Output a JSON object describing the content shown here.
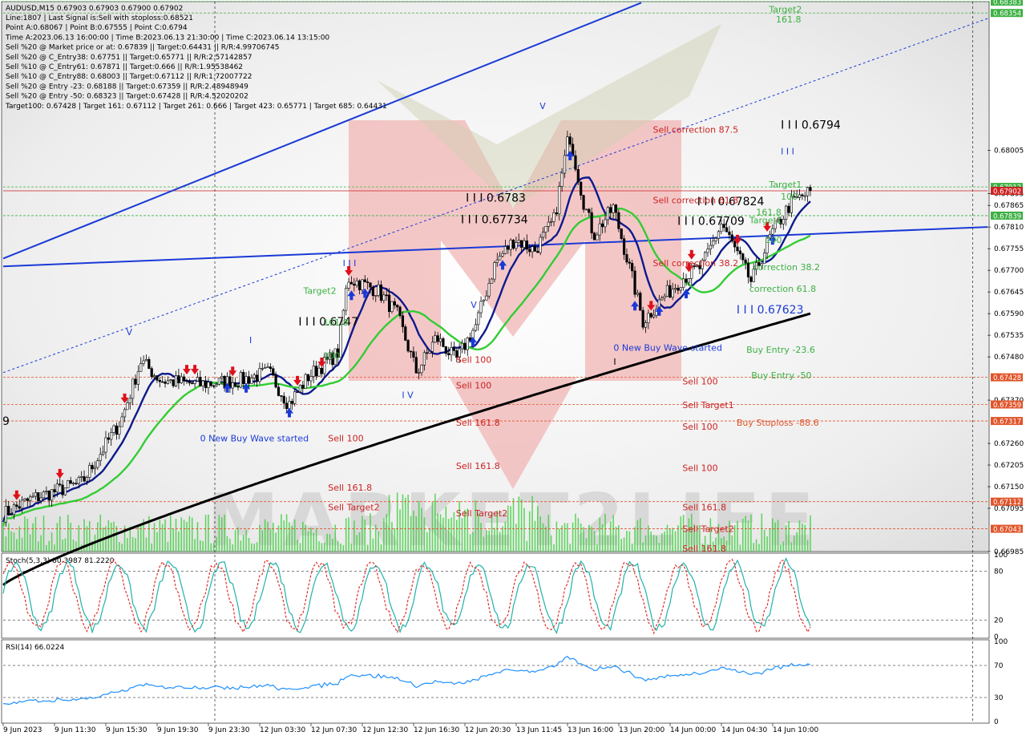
{
  "header": {
    "symbol_line": "AUDUSD,M15  0.67903 0.67903 0.67900 0.67902",
    "info_lines": [
      "Line:1807 | Last Signal is:Sell with stoploss:0.68521",
      "Point A:0.68067 | Point B:0.67555 | Point C:0.6794",
      "Time A:2023.06.13 16:00:00 | Time B:2023.06.13 21:30:00 | Time C:2023.06.14 13:15:00",
      "Sell %20 @ Market price or at: 0.67839 || Target:0.64431 || R/R:4.99706745",
      "Sell %20 @ C_Entry38: 0.67751 || Target:0.65771 || R/R:2.57142857",
      "Sell %10 @ C_Entry61: 0.67871 || Target:0.666 || R/R:1.95538462",
      "Sell %10 @ C_Entry88: 0.68003 || Target:0.67112 || R/R:1.72007722",
      "Sell %20 @ Entry -23: 0.68188 || Target:0.67359 || R/R:2.48948949",
      "Sell %20 @ Entry -50: 0.68323 || Target:0.67428 || R/R:4.52020202",
      "Target100: 0.67428 | Target 161: 0.67112 | Target 261: 0.666 | Target 423: 0.65771 | Target 685: 0.64431"
    ],
    "left_edge_char": "9"
  },
  "chart_data": {
    "type": "candlestick",
    "symbol": "AUDUSD",
    "timeframe": "M15",
    "ohlc_last": {
      "open": 0.67903,
      "high": 0.67903,
      "low": 0.679,
      "close": 0.67902
    },
    "price_axis": {
      "ylim": [
        0.66985,
        0.68383
      ],
      "ticks": [
        0.68005,
        0.67895,
        0.67865,
        0.6781,
        0.67755,
        0.677,
        0.67645,
        0.6759,
        0.67535,
        0.6748,
        0.6737,
        0.6726,
        0.67205,
        0.6715,
        0.67095,
        0.66985
      ],
      "tick_labels": [
        "0.68005",
        "0.67895",
        "0.67865",
        "0.67810",
        "0.67755",
        "0.67700",
        "0.67645",
        "0.67590",
        "0.67535",
        "0.67480",
        "0.67370",
        "0.67260",
        "0.67205",
        "0.67150",
        "0.67095",
        "0.66985"
      ],
      "partial_labels": [
        "0.67425"
      ],
      "badges": [
        {
          "text": "0.68383",
          "color": "#3cb043"
        },
        {
          "text": "0.68354",
          "color": "#3cb043"
        },
        {
          "text": "0.67912",
          "color": "#3cb043"
        },
        {
          "text": "0.67902",
          "color": "#cc2222"
        },
        {
          "text": "0.67839",
          "color": "#3cb043"
        },
        {
          "text": "0.67428",
          "color": "#e0552b"
        },
        {
          "text": "0.67359",
          "color": "#e0552b"
        },
        {
          "text": "0.67317",
          "color": "#e0552b"
        },
        {
          "text": "0.67112",
          "color": "#e0552b"
        },
        {
          "text": "0.67043",
          "color": "#e0552b"
        }
      ]
    },
    "time_axis": {
      "labels": [
        "9 Jun 2023",
        "9 Jun 11:30",
        "9 Jun 15:30",
        "9 Jun 19:30",
        "9 Jun 23:30",
        "12 Jun 03:30",
        "12 Jun 07:30",
        "12 Jun 12:30",
        "12 Jun 16:30",
        "12 Jun 20:30",
        "13 Jun 11:45",
        "13 Jun 16:00",
        "13 Jun 20:00",
        "14 Jun 00:00",
        "14 Jun 04:30",
        "14 Jun 10:00"
      ]
    },
    "levels": [
      {
        "price": 0.68383,
        "color": "#3cb043",
        "style": "dashed"
      },
      {
        "price": 0.68354,
        "color": "#3cb043",
        "style": "dashed"
      },
      {
        "price": 0.67912,
        "color": "#3cb043",
        "style": "dashed"
      },
      {
        "price": 0.67902,
        "color": "#cc2222",
        "style": "solid"
      },
      {
        "price": 0.67839,
        "color": "#3cb043",
        "style": "dashed"
      },
      {
        "price": 0.67428,
        "color": "#e0552b",
        "style": "dashed"
      },
      {
        "price": 0.67359,
        "color": "#e0552b",
        "style": "dashed"
      },
      {
        "price": 0.67317,
        "color": "#e0552b",
        "style": "dashed"
      },
      {
        "price": 0.67112,
        "color": "#e0552b",
        "style": "dashed"
      },
      {
        "price": 0.67043,
        "color": "#e0552b",
        "style": "dashed"
      }
    ],
    "price_labels": [
      {
        "text": "I I I 0.6794",
        "price": 0.6806,
        "time": 0.79,
        "color": "#000000"
      },
      {
        "text": "I I I 0.6783",
        "price": 0.67875,
        "time": 0.47,
        "color": "#000000"
      },
      {
        "text": "I I I 0.67824",
        "price": 0.67865,
        "time": 0.705,
        "color": "#000000"
      },
      {
        "text": "I I I 0.67734",
        "price": 0.6782,
        "time": 0.465,
        "color": "#000000"
      },
      {
        "text": "I I I 0.67709",
        "price": 0.67815,
        "time": 0.685,
        "color": "#000000"
      },
      {
        "text": "I I I 0.6747",
        "price": 0.6756,
        "time": 0.3,
        "color": "#000000"
      },
      {
        "text": "I I I 0.67623",
        "price": 0.6759,
        "time": 0.745,
        "color": "#1a3ad6"
      }
    ],
    "signal_labels": [
      {
        "text": "Target2",
        "price": 0.68355,
        "time": 0.778,
        "color": "#3cb043"
      },
      {
        "text": "161.8",
        "price": 0.6833,
        "time": 0.785,
        "color": "#3cb043"
      },
      {
        "text": "Target1",
        "price": 0.6791,
        "time": 0.778,
        "color": "#3cb043"
      },
      {
        "text": "100",
        "price": 0.6788,
        "time": 0.79,
        "color": "#3cb043"
      },
      {
        "text": "161.8",
        "price": 0.6784,
        "time": 0.765,
        "color": "#3cb043"
      },
      {
        "text": "Target1",
        "price": 0.6782,
        "time": 0.758,
        "color": "#3cb043"
      },
      {
        "text": "100",
        "price": 0.6777,
        "time": 0.774,
        "color": "#3cb043"
      },
      {
        "text": "correction 38.2",
        "price": 0.677,
        "time": 0.762,
        "color": "#3cb043"
      },
      {
        "text": "correction 61.8",
        "price": 0.67645,
        "time": 0.758,
        "color": "#3cb043"
      },
      {
        "text": "Target2",
        "price": 0.6764,
        "time": 0.305,
        "color": "#3cb043"
      },
      {
        "text": "161.8",
        "price": 0.6756,
        "time": 0.325,
        "color": "#3cb043"
      },
      {
        "text": "100",
        "price": 0.67475,
        "time": 0.325,
        "color": "#3cb043"
      },
      {
        "text": "Buy Entry -23.6",
        "price": 0.6749,
        "time": 0.755,
        "color": "#3cb043"
      },
      {
        "text": "Buy Entry -50",
        "price": 0.67425,
        "time": 0.76,
        "color": "#3cb043"
      },
      {
        "text": "Buy Stoploss -88.6",
        "price": 0.67305,
        "time": 0.745,
        "color": "#e0552b"
      },
      {
        "text": "Sell correction 87.5",
        "price": 0.6805,
        "time": 0.66,
        "color": "#cc2222"
      },
      {
        "text": "Sell correction 61.8",
        "price": 0.6787,
        "time": 0.66,
        "color": "#cc2222"
      },
      {
        "text": "Sell correction 38.2",
        "price": 0.6771,
        "time": 0.66,
        "color": "#cc2222"
      },
      {
        "text": "Sell 100",
        "price": 0.674,
        "time": 0.46,
        "color": "#cc2222"
      },
      {
        "text": "Sell 100",
        "price": 0.67465,
        "time": 0.46,
        "color": "#cc2222"
      },
      {
        "text": "Sell 161.8",
        "price": 0.67305,
        "time": 0.46,
        "color": "#cc2222"
      },
      {
        "text": "Sell 100",
        "price": 0.67265,
        "time": 0.33,
        "color": "#cc2222"
      },
      {
        "text": "Sell 161.8",
        "price": 0.67195,
        "time": 0.46,
        "color": "#cc2222"
      },
      {
        "text": "Sell 161.8",
        "price": 0.6714,
        "time": 0.33,
        "color": "#cc2222"
      },
      {
        "text": "Sell Target2",
        "price": 0.6709,
        "time": 0.33,
        "color": "#cc2222"
      },
      {
        "text": "Sell Target2",
        "price": 0.67075,
        "time": 0.46,
        "color": "#cc2222"
      },
      {
        "text": "Sell 100",
        "price": 0.6741,
        "time": 0.69,
        "color": "#cc2222"
      },
      {
        "text": "Sell Target1",
        "price": 0.6735,
        "time": 0.69,
        "color": "#cc2222"
      },
      {
        "text": "Sell 100",
        "price": 0.67295,
        "time": 0.69,
        "color": "#cc2222"
      },
      {
        "text": "Sell 100",
        "price": 0.6719,
        "time": 0.69,
        "color": "#cc2222"
      },
      {
        "text": "Sell 161.8",
        "price": 0.6709,
        "time": 0.69,
        "color": "#cc2222"
      },
      {
        "text": "Sell Target2",
        "price": 0.67035,
        "time": 0.69,
        "color": "#cc2222"
      },
      {
        "text": "Sell 161.8",
        "price": 0.66985,
        "time": 0.69,
        "color": "#cc2222"
      },
      {
        "text": "0 New Buy Wave started",
        "price": 0.67265,
        "time": 0.2,
        "color": "#1a3ad6"
      },
      {
        "text": "0 New Buy Wave started",
        "price": 0.67495,
        "time": 0.62,
        "color": "#1a3ad6"
      },
      {
        "text": "V",
        "price": 0.67535,
        "time": 0.125,
        "color": "#1a3ad6"
      },
      {
        "text": "V",
        "price": 0.6811,
        "time": 0.545,
        "color": "#1a3ad6"
      },
      {
        "text": "V",
        "price": 0.67605,
        "time": 0.475,
        "color": "#1a3ad6"
      },
      {
        "text": "I I I",
        "price": 0.6771,
        "time": 0.345,
        "color": "#1a3ad6"
      },
      {
        "text": "I I I",
        "price": 0.67995,
        "time": 0.79,
        "color": "#1a3ad6"
      },
      {
        "text": "I",
        "price": 0.67515,
        "time": 0.25,
        "color": "#1a3ad6"
      },
      {
        "text": "I V",
        "price": 0.67375,
        "time": 0.405,
        "color": "#1a3ad6"
      },
      {
        "text": "I",
        "price": 0.6746,
        "time": 0.62,
        "color": "#000000"
      }
    ],
    "indicators": [
      {
        "name": "Stoch(5,3,3)",
        "label": "Stoch(5,3,3) 80.3987 81.2220",
        "ylim": [
          0,
          100
        ],
        "levels": [
          80,
          20
        ],
        "tick_labels": [
          "100",
          "80",
          "20",
          "0"
        ]
      },
      {
        "name": "RSI(14)",
        "label": "RSI(14) 66.0224",
        "ylim": [
          0,
          100
        ],
        "levels": [
          70,
          30
        ],
        "tick_labels": [
          "100",
          "70",
          "30",
          "0"
        ]
      }
    ],
    "watermark_text": "MARKET2LIFE",
    "colors": {
      "candle": "#000000",
      "ma_fast": "#0d1a8c",
      "ma_mid": "#33cc33",
      "ma_slow": "#000000",
      "channel": "#1a3ad6",
      "volume": "#33cc33",
      "stoch_main": "#20b2aa",
      "stoch_signal": "#e0302a",
      "rsi": "#1e90ff"
    }
  }
}
